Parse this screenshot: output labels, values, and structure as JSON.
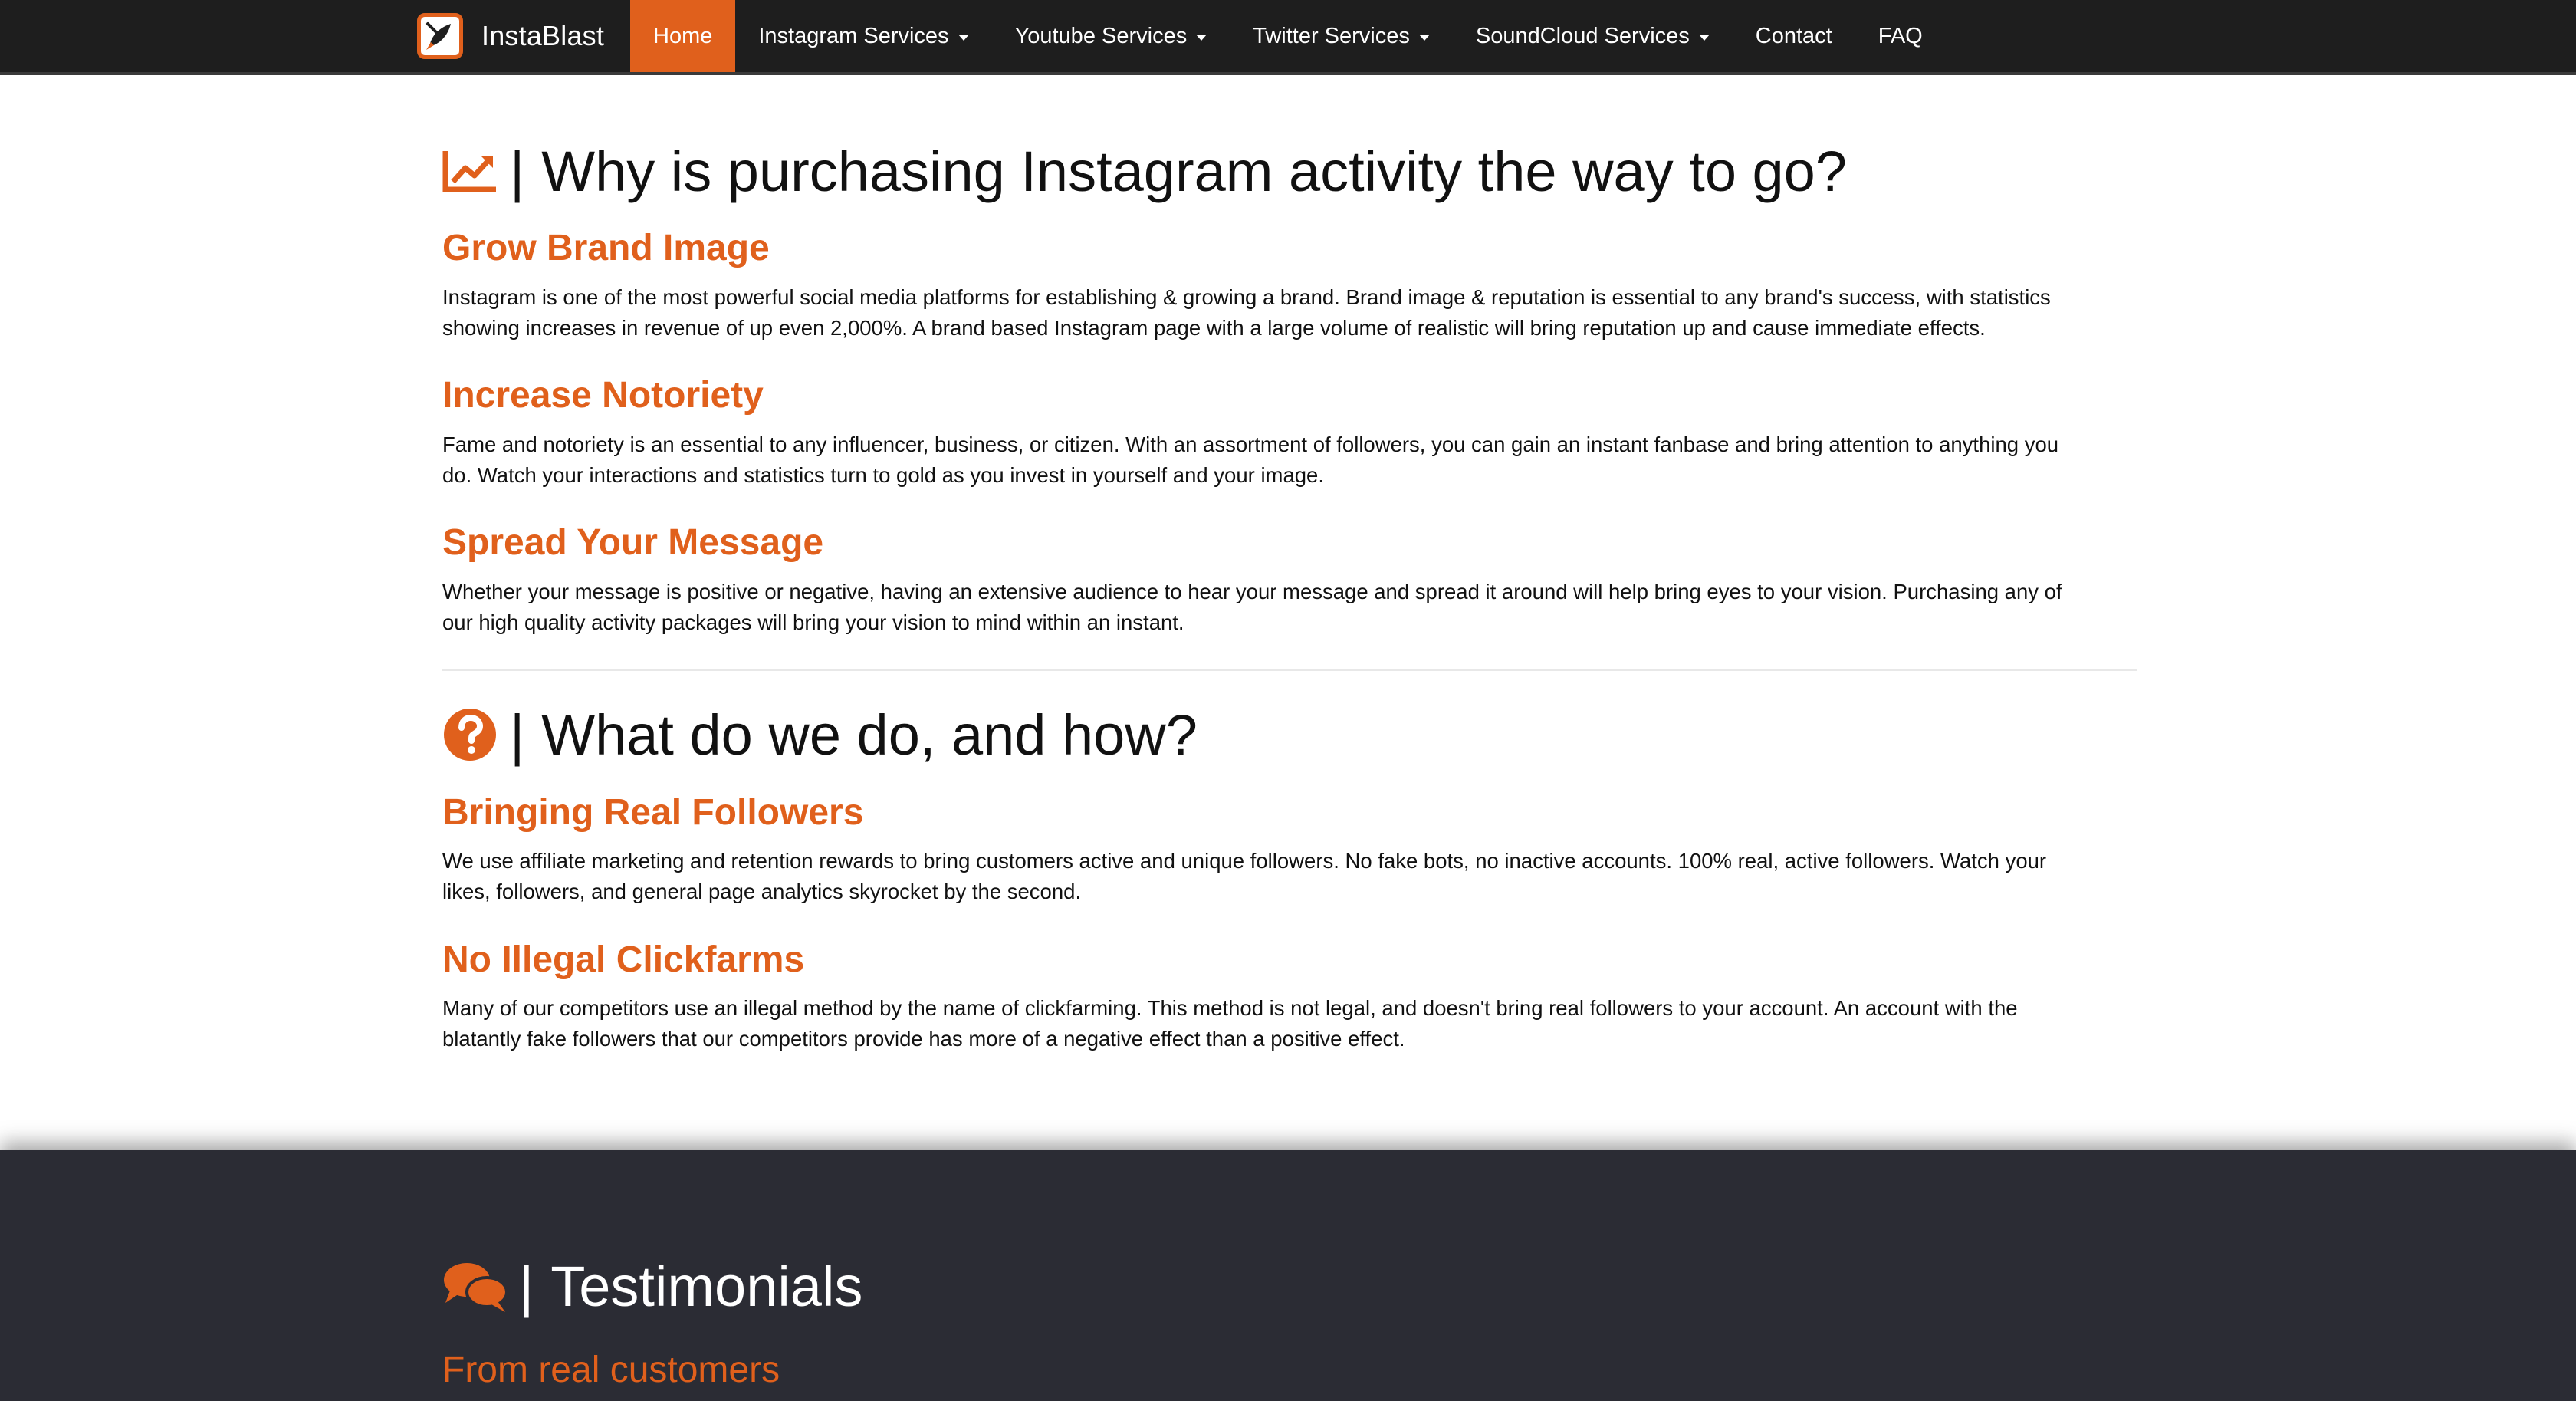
{
  "brand": {
    "name": "InstaBlast",
    "logo_icon": "rocket-logo-icon"
  },
  "nav": {
    "home": "Home",
    "instagram": "Instagram Services",
    "youtube": "Youtube Services",
    "twitter": "Twitter Services",
    "soundcloud": "SoundCloud Services",
    "contact": "Contact",
    "faq": "FAQ"
  },
  "colors": {
    "accent": "#e0601c",
    "navbar": "#1e1e1e",
    "footer": "#2b2c34"
  },
  "section1": {
    "icon": "chart-line-icon",
    "separator": "|",
    "title": "Why is purchasing Instagram activity the way to go?",
    "items": [
      {
        "heading": "Grow Brand Image",
        "line1": "Instagram is one of the most powerful social media platforms for establishing & growing a brand. Brand image & reputation is essential to any brand's success, with statistics",
        "line2": "showing increases in revenue of up even 2,000%. A brand based Instagram page with a large volume of realistic will bring reputation up and cause immediate effects."
      },
      {
        "heading": "Increase Notoriety",
        "line1": "Fame and notoriety is an essential to any influencer, business, or citizen. With an assortment of followers, you can gain an instant fanbase and bring attention to anything you",
        "line2": "do. Watch your interactions and statistics turn to gold as you invest in yourself and your image."
      },
      {
        "heading": "Spread Your Message",
        "line1": "Whether your message is positive or negative, having an extensive audience to hear your message and spread it around will help bring eyes to your vision. Purchasing any of",
        "line2": "our high quality activity packages will bring your vision to mind within an instant."
      }
    ]
  },
  "section2": {
    "icon": "question-circle-icon",
    "separator": "|",
    "title": "What do we do, and how?",
    "items": [
      {
        "heading": "Bringing Real Followers",
        "line1": "We use affiliate marketing and retention rewards to bring customers active and unique followers. No fake bots, no inactive accounts. 100% real, active followers. Watch your",
        "line2": "likes, followers, and general page analytics skyrocket by the second."
      },
      {
        "heading": "No Illegal Clickfarms",
        "line1": "Many of our competitors use an illegal method by the name of clickfarming. This method is not legal, and doesn't bring real followers to your account. An account with the",
        "line2": "blatantly fake followers that our competitors provide has more of a negative effect than a positive effect."
      }
    ]
  },
  "testimonials": {
    "icon": "comments-icon",
    "separator": "|",
    "title": "Testimonials",
    "subtitle": "From real customers"
  }
}
